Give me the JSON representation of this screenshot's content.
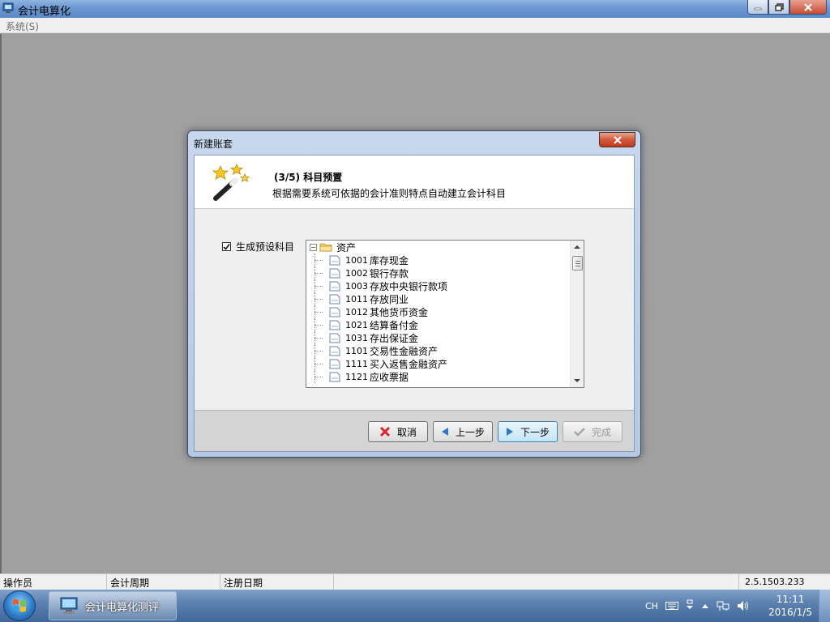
{
  "window": {
    "title": "会计电算化"
  },
  "menu": {
    "items": [
      "系统(S)"
    ]
  },
  "dialog": {
    "title": "新建账套",
    "step": "(3/5) 科目预置",
    "description": "根据需要系统可依据的会计准则特点自动建立会计科目",
    "checkbox": {
      "label": "生成预设科目",
      "checked": true
    },
    "tree": {
      "root": "资产",
      "items": [
        {
          "code": "1001",
          "name": "库存现金"
        },
        {
          "code": "1002",
          "name": "银行存款"
        },
        {
          "code": "1003",
          "name": "存放中央银行款项"
        },
        {
          "code": "1011",
          "name": "存放同业"
        },
        {
          "code": "1012",
          "name": "其他货币资金"
        },
        {
          "code": "1021",
          "name": "结算备付金"
        },
        {
          "code": "1031",
          "name": "存出保证金"
        },
        {
          "code": "1101",
          "name": "交易性金融资产"
        },
        {
          "code": "1111",
          "name": "买入返售金融资产"
        },
        {
          "code": "1121",
          "name": "应收票据"
        }
      ]
    },
    "buttons": {
      "cancel": "取消",
      "prev": "上一步",
      "next": "下一步",
      "finish": "完成"
    }
  },
  "statusbar": {
    "operator": "操作员",
    "period": "会计周期",
    "reg_date": "注册日期",
    "version": "2.5.1503.233"
  },
  "taskbar": {
    "task_label": "会计电算化测评",
    "lang": "CH",
    "time": "11:11",
    "date": "2016/1/5"
  }
}
